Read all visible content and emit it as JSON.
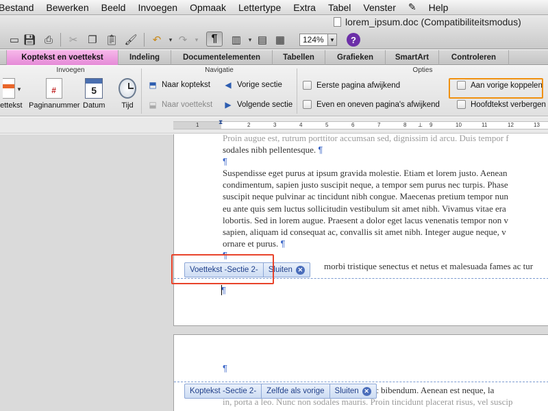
{
  "menubar": {
    "items": [
      "Bestand",
      "Bewerken",
      "Beeld",
      "Invoegen",
      "Opmaak",
      "Lettertype",
      "Extra",
      "Tabel",
      "Venster",
      "Help"
    ],
    "script_icon": "script-icon"
  },
  "window": {
    "title": "lorem_ipsum.doc (Compatibiliteitsmodus)"
  },
  "toolbar": {
    "zoom": "124%"
  },
  "ribbon": {
    "tabs": [
      "Koptekst en voettekst",
      "Indeling",
      "Documentelementen",
      "Tabellen",
      "Grafieken",
      "SmartArt",
      "Controleren"
    ],
    "active_tab": "Koptekst en voettekst",
    "active_color": "#ee9ee0",
    "groups": {
      "insert": {
        "title": "Invoegen",
        "buttons": [
          "oettekst",
          "Paginanummer",
          "Datum",
          "Tijd"
        ],
        "calendar_day": "5"
      },
      "navigation": {
        "title": "Navigatie",
        "buttons": [
          "Naar koptekst",
          "Naar voettekst",
          "Vorige sectie",
          "Volgende sectie"
        ]
      },
      "options": {
        "title": "Opties",
        "checkboxes": [
          "Eerste pagina afwijkend",
          "Even en oneven pagina's afwijkend",
          "Aan vorige koppelen",
          "Hoofdtekst verbergen"
        ],
        "highlight_color": "#f0900e"
      }
    }
  },
  "ruler": {
    "labels": [
      "1",
      "2",
      "3",
      "4",
      "5",
      "6",
      "7",
      "8",
      "9",
      "10",
      "11",
      "12",
      "13"
    ]
  },
  "document": {
    "page1_lines": [
      "Proin augue est, rutrum porttitor accumsan sed, dignissim id arcu. Duis tempor f",
      "sodales nibh pellentesque.",
      "",
      "Suspendisse eget purus at ipsum gravida molestie. Etiam et lorem justo. Aenean",
      "condimentum, sapien justo suscipit neque, a tempor sem purus nec turpis. Phase",
      "suscipit neque pulvinar ac tincidunt nibh congue. Maecenas pretium tempor nun",
      "eu ante quis sem luctus sollicitudin vestibulum sit amet nibh. Vivamus vitae era",
      "lobortis. Sed in lorem augue. Praesent a dolor eget lacus venenatis tempor non v",
      "sapien, aliquam id consequat ac, convallis sit amet nibh. Integer augue neque, v",
      "ornare et purus.",
      "",
      "morbi tristique senectus et netus et malesuada fames ac tur"
    ],
    "paragraph_mark": "¶",
    "footer_label": "Voettekst -Sectie 2-",
    "footer_close": "Sluiten",
    "header_label": "Koptekst -Sectie 2-",
    "header_same_as_previous": "Zelfde als vorige",
    "header_close": "Sluiten",
    "page2_lines": [
      "ue nunc bibendum. Aenean est neque, la",
      "in, porta a leo. Nunc non sodales mauris. Proin tincidunt placerat risus, vel suscip"
    ],
    "callout_color": "#e8432a"
  }
}
